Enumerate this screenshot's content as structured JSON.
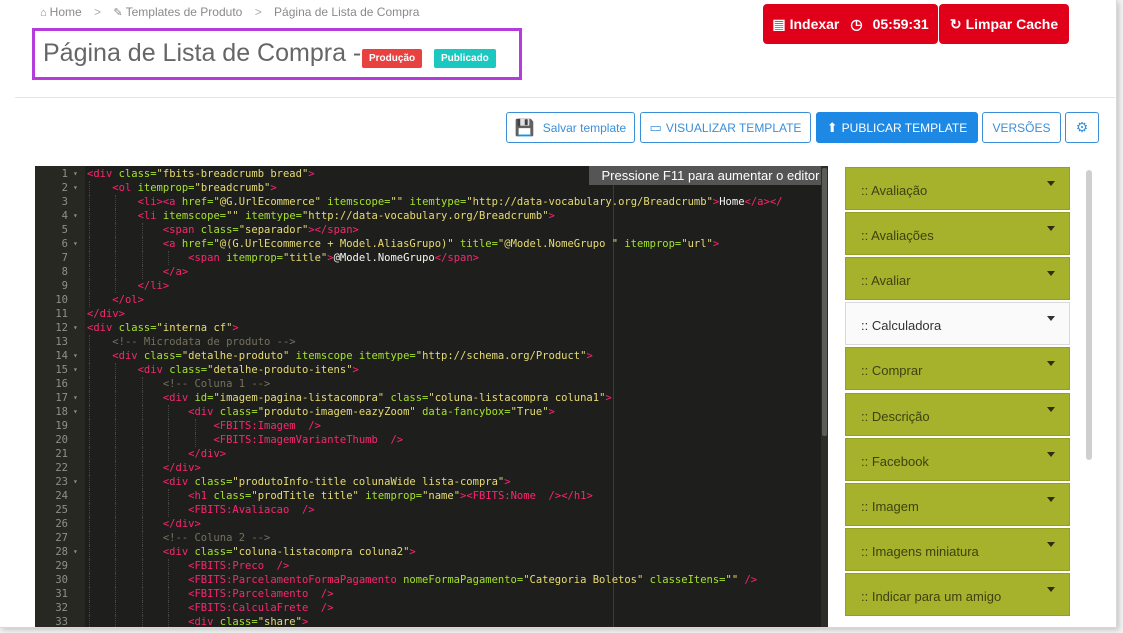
{
  "breadcrumb": {
    "home_icon": "home-icon",
    "home": "Home",
    "sep1": ">",
    "templates_icon": "edit-icon",
    "templates": "Templates de Produto",
    "sep2": ">",
    "current": "Página de Lista de Compra"
  },
  "header": {
    "title": "Página de Lista de Compra -",
    "badge_env": "Produção",
    "badge_status": "Publicado",
    "index_icon": "list-icon",
    "index_label": "Indexar",
    "timer_icon": "clock-icon",
    "timer": "05:59:31",
    "cache_icon": "refresh-icon",
    "cache_label": "Limpar Cache",
    "accent_red": "#e0001a",
    "highlight_border": "#b43cdb"
  },
  "toolbar": {
    "save_icon": "save-icon",
    "save_label": "Salvar template",
    "view_icon": "monitor-icon",
    "view_label": "VISUALIZAR TEMPLATE",
    "publish_icon": "upload-icon",
    "publish_label": "PUBLICAR TEMPLATE",
    "versions_label": "VERSÕES",
    "settings_icon": "gear-icon"
  },
  "editor": {
    "hint": "Pressione F11 para aumentar o editor",
    "lines": [
      [
        [
          "t",
          "<div "
        ],
        [
          "a",
          "class="
        ],
        [
          "s",
          "\"fbits-breadcrumb bread\""
        ],
        [
          "t",
          ">"
        ]
      ],
      [
        [
          "w",
          "    "
        ],
        [
          "t",
          "<ol "
        ],
        [
          "a",
          "itemprop="
        ],
        [
          "s",
          "\"breadcrumb\""
        ],
        [
          "t",
          ">"
        ]
      ],
      [
        [
          "w",
          "        "
        ],
        [
          "t",
          "<li><a "
        ],
        [
          "a",
          "href="
        ],
        [
          "s",
          "\"@G.UrlEcommerce\""
        ],
        [
          "w",
          " "
        ],
        [
          "a",
          "itemscope="
        ],
        [
          "s",
          "\"\""
        ],
        [
          "w",
          " "
        ],
        [
          "a",
          "itemtype="
        ],
        [
          "s",
          "\"http://data-vocabulary.org/Breadcrumb\""
        ],
        [
          "t",
          ">"
        ],
        [
          "w",
          "Home"
        ],
        [
          "t",
          "</a></"
        ]
      ],
      [
        [
          "w",
          "        "
        ],
        [
          "t",
          "<li "
        ],
        [
          "a",
          "itemscope="
        ],
        [
          "s",
          "\"\""
        ],
        [
          "w",
          " "
        ],
        [
          "a",
          "itemtype="
        ],
        [
          "s",
          "\"http://data-vocabulary.org/Breadcrumb\""
        ],
        [
          "t",
          ">"
        ]
      ],
      [
        [
          "w",
          "            "
        ],
        [
          "t",
          "<span "
        ],
        [
          "a",
          "class="
        ],
        [
          "s",
          "\"separador\""
        ],
        [
          "t",
          "></span>"
        ]
      ],
      [
        [
          "w",
          "            "
        ],
        [
          "t",
          "<a "
        ],
        [
          "a",
          "href="
        ],
        [
          "s",
          "\"@(G.UrlEcommerce + Model.AliasGrupo)\""
        ],
        [
          "w",
          " "
        ],
        [
          "a",
          "title="
        ],
        [
          "s",
          "\"@Model.NomeGrupo \""
        ],
        [
          "w",
          " "
        ],
        [
          "a",
          "itemprop="
        ],
        [
          "s",
          "\"url\""
        ],
        [
          "t",
          ">"
        ]
      ],
      [
        [
          "w",
          "                "
        ],
        [
          "t",
          "<span "
        ],
        [
          "a",
          "itemprop="
        ],
        [
          "s",
          "\"title\""
        ],
        [
          "t",
          ">"
        ],
        [
          "w",
          "@Model.NomeGrupo"
        ],
        [
          "t",
          "</span>"
        ]
      ],
      [
        [
          "w",
          "            "
        ],
        [
          "t",
          "</a>"
        ]
      ],
      [
        [
          "w",
          "        "
        ],
        [
          "t",
          "</li>"
        ]
      ],
      [
        [
          "w",
          "    "
        ],
        [
          "t",
          "</ol>"
        ]
      ],
      [
        [
          "t",
          "</div>"
        ]
      ],
      [
        [
          "t",
          "<div "
        ],
        [
          "a",
          "class="
        ],
        [
          "s",
          "\"interna cf\""
        ],
        [
          "t",
          ">"
        ]
      ],
      [
        [
          "w",
          "    "
        ],
        [
          "c",
          "<!-- Microdata de produto -->"
        ]
      ],
      [
        [
          "w",
          "    "
        ],
        [
          "t",
          "<div "
        ],
        [
          "a",
          "class="
        ],
        [
          "s",
          "\"detalhe-produto\""
        ],
        [
          "w",
          " "
        ],
        [
          "a",
          "itemscope itemtype="
        ],
        [
          "s",
          "\"http://schema.org/Product\""
        ],
        [
          "t",
          ">"
        ]
      ],
      [
        [
          "w",
          "        "
        ],
        [
          "t",
          "<div "
        ],
        [
          "a",
          "class="
        ],
        [
          "s",
          "\"detalhe-produto-itens\""
        ],
        [
          "t",
          ">"
        ]
      ],
      [
        [
          "w",
          "            "
        ],
        [
          "c",
          "<!-- Coluna 1 -->"
        ]
      ],
      [
        [
          "w",
          "            "
        ],
        [
          "t",
          "<div "
        ],
        [
          "a",
          "id="
        ],
        [
          "s",
          "\"imagem-pagina-listacompra\""
        ],
        [
          "w",
          " "
        ],
        [
          "a",
          "class="
        ],
        [
          "s",
          "\"coluna-listacompra coluna1\""
        ],
        [
          "t",
          ">"
        ]
      ],
      [
        [
          "w",
          "                "
        ],
        [
          "t",
          "<div "
        ],
        [
          "a",
          "class="
        ],
        [
          "s",
          "\"produto-imagem-eazyZoom\""
        ],
        [
          "w",
          " "
        ],
        [
          "a",
          "data-fancybox="
        ],
        [
          "s",
          "\"True\""
        ],
        [
          "t",
          ">"
        ]
      ],
      [
        [
          "w",
          "                    "
        ],
        [
          "t",
          "<FBITS:Imagem"
        ],
        [
          "w",
          "  "
        ],
        [
          "t",
          "/>"
        ]
      ],
      [
        [
          "w",
          "                    "
        ],
        [
          "t",
          "<FBITS:ImagemVarianteThumb"
        ],
        [
          "w",
          "  "
        ],
        [
          "t",
          "/>"
        ]
      ],
      [
        [
          "w",
          "                "
        ],
        [
          "t",
          "</div>"
        ]
      ],
      [
        [
          "w",
          "            "
        ],
        [
          "t",
          "</div>"
        ]
      ],
      [
        [
          "w",
          "            "
        ],
        [
          "t",
          "<div "
        ],
        [
          "a",
          "class="
        ],
        [
          "s",
          "\"produtoInfo-title colunaWide lista-compra\""
        ],
        [
          "t",
          ">"
        ]
      ],
      [
        [
          "w",
          "                "
        ],
        [
          "t",
          "<h1 "
        ],
        [
          "a",
          "class="
        ],
        [
          "s",
          "\"prodTitle title\""
        ],
        [
          "w",
          " "
        ],
        [
          "a",
          "itemprop="
        ],
        [
          "s",
          "\"name\""
        ],
        [
          "t",
          "><FBITS:Nome"
        ],
        [
          "w",
          "  "
        ],
        [
          "t",
          "/></h1>"
        ]
      ],
      [
        [
          "w",
          "                "
        ],
        [
          "t",
          "<FBITS:Avaliacao"
        ],
        [
          "w",
          "  "
        ],
        [
          "t",
          "/>"
        ]
      ],
      [
        [
          "w",
          "            "
        ],
        [
          "t",
          "</div>"
        ]
      ],
      [
        [
          "w",
          "            "
        ],
        [
          "c",
          "<!-- Coluna 2 -->"
        ]
      ],
      [
        [
          "w",
          "            "
        ],
        [
          "t",
          "<div "
        ],
        [
          "a",
          "class="
        ],
        [
          "s",
          "\"coluna-listacompra coluna2\""
        ],
        [
          "t",
          ">"
        ]
      ],
      [
        [
          "w",
          "                "
        ],
        [
          "t",
          "<FBITS:Preco"
        ],
        [
          "w",
          "  "
        ],
        [
          "t",
          "/>"
        ]
      ],
      [
        [
          "w",
          "                "
        ],
        [
          "t",
          "<FBITS:ParcelamentoFormaPagamento "
        ],
        [
          "a",
          "nomeFormaPagamento="
        ],
        [
          "s",
          "\"Categoria Boletos\""
        ],
        [
          "w",
          " "
        ],
        [
          "a",
          "classeItens="
        ],
        [
          "s",
          "\"\""
        ],
        [
          "w",
          " "
        ],
        [
          "t",
          "/>"
        ]
      ],
      [
        [
          "w",
          "                "
        ],
        [
          "t",
          "<FBITS:Parcelamento"
        ],
        [
          "w",
          "  "
        ],
        [
          "t",
          "/>"
        ]
      ],
      [
        [
          "w",
          "                "
        ],
        [
          "t",
          "<FBITS:CalculaFrete"
        ],
        [
          "w",
          "  "
        ],
        [
          "t",
          "/>"
        ]
      ],
      [
        [
          "w",
          "                "
        ],
        [
          "t",
          "<div "
        ],
        [
          "a",
          "class="
        ],
        [
          "s",
          "\"share\""
        ],
        [
          "t",
          ">"
        ]
      ]
    ]
  },
  "panel": {
    "items": [
      {
        "label": ":: Avaliação",
        "active": false
      },
      {
        "label": ":: Avaliações",
        "active": false
      },
      {
        "label": ":: Avaliar",
        "active": false
      },
      {
        "label": ":: Calculadora",
        "active": true
      },
      {
        "label": ":: Comprar",
        "active": false
      },
      {
        "label": ":: Descrição",
        "active": false
      },
      {
        "label": ":: Facebook",
        "active": false
      },
      {
        "label": ":: Imagem",
        "active": false
      },
      {
        "label": ":: Imagens miniatura",
        "active": false
      },
      {
        "label": ":: Indicar para um amigo",
        "active": false
      }
    ],
    "accent": "#a6b12c"
  }
}
